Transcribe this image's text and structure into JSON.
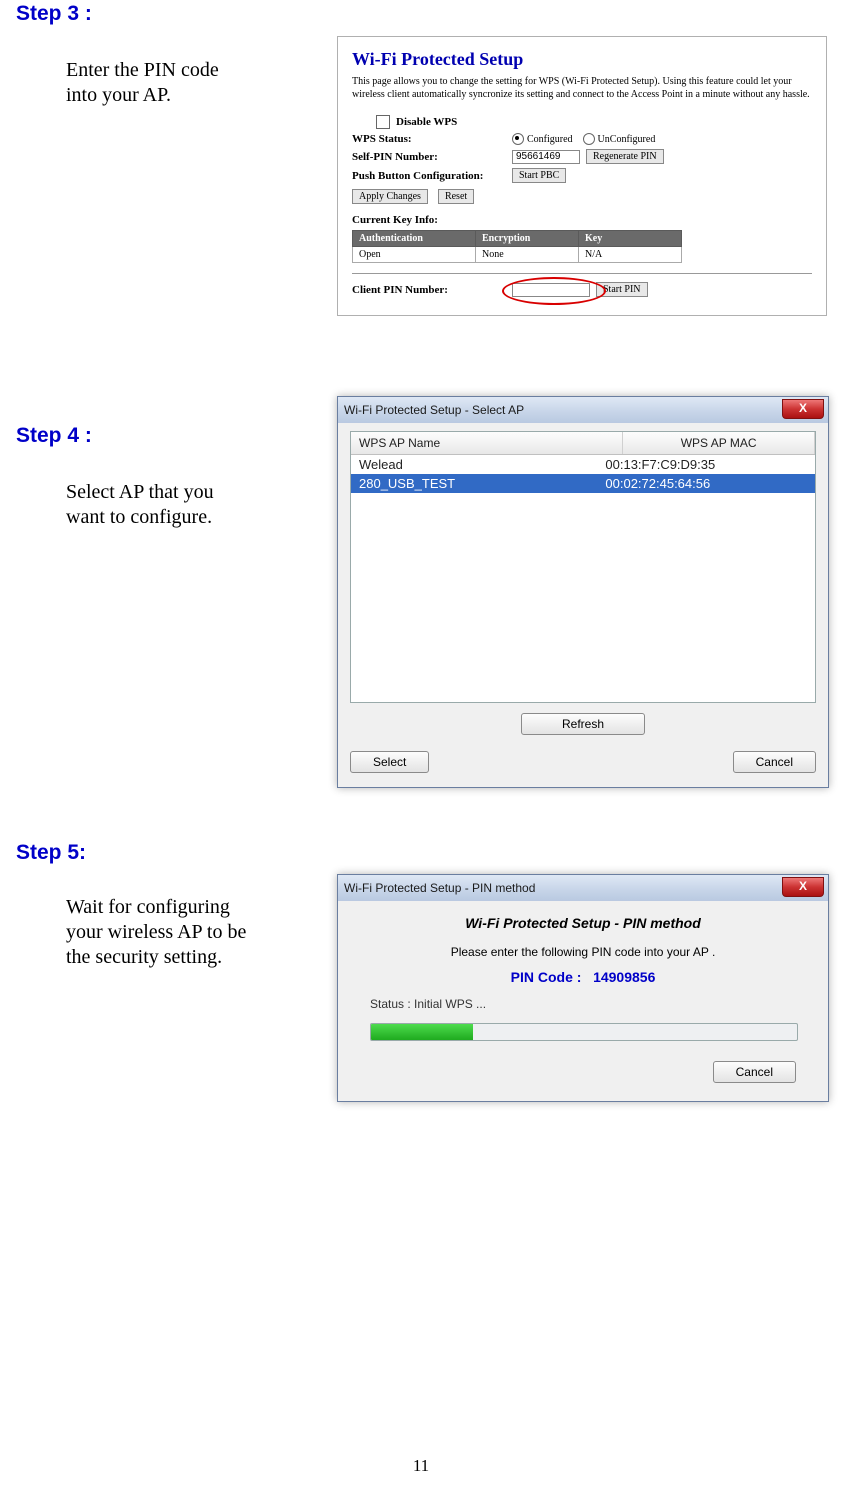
{
  "page_number": "11",
  "step3": {
    "heading": "Step 3 :",
    "body_line1": "Enter the PIN code",
    "body_line2": "into your AP."
  },
  "fig3": {
    "title": "Wi-Fi Protected Setup",
    "desc": "This page allows you to change the setting for WPS (Wi-Fi Protected Setup). Using this feature could let your wireless client automatically syncronize its setting and connect to the Access Point in a minute without any hassle.",
    "disable_wps_label": "Disable WPS",
    "wps_status_label": "WPS Status:",
    "wps_status_configured": "Configured",
    "wps_status_unconfigured": "UnConfigured",
    "self_pin_label": "Self-PIN Number:",
    "self_pin_value": "95661469",
    "regen_pin_btn": "Regenerate PIN",
    "pbc_label": "Push Button Configuration:",
    "start_pbc_btn": "Start PBC",
    "apply_changes_btn": "Apply Changes",
    "reset_btn": "Reset",
    "current_key_label": "Current Key Info:",
    "table_headers": {
      "auth": "Authentication",
      "enc": "Encryption",
      "key": "Key"
    },
    "table_row": {
      "auth": "Open",
      "enc": "None",
      "key": "N/A"
    },
    "client_pin_label": "Client PIN Number:",
    "client_pin_value": "",
    "start_pin_btn": "Start PIN"
  },
  "step4": {
    "heading": "Step 4 :",
    "body_line1": "Select AP that you",
    "body_line2": "want to configure."
  },
  "fig4": {
    "title": "Wi-Fi Protected Setup - Select AP",
    "col_name": "WPS AP Name",
    "col_mac": "WPS AP MAC",
    "rows": [
      {
        "name": "Welead",
        "mac": "00:13:F7:C9:D9:35",
        "selected": false
      },
      {
        "name": "280_USB_TEST",
        "mac": "00:02:72:45:64:56",
        "selected": true
      }
    ],
    "refresh_btn": "Refresh",
    "select_btn": "Select",
    "cancel_btn": "Cancel"
  },
  "step5": {
    "heading": "Step 5:",
    "body_line1": "Wait for configuring",
    "body_line2": "your wireless AP to be",
    "body_line3": "the security setting."
  },
  "fig5": {
    "title": "Wi-Fi Protected Setup - PIN method",
    "header": "Wi-Fi Protected Setup - PIN method",
    "note": "Please enter the following PIN code into your AP .",
    "pin_label": "PIN Code :",
    "pin_value": "14909856",
    "status": "Status : Initial WPS ...",
    "progress_percent": 24,
    "cancel_btn": "Cancel"
  }
}
